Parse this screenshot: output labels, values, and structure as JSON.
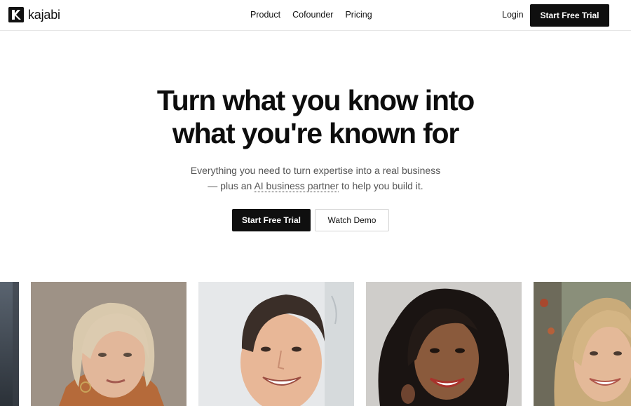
{
  "brand": {
    "name": "kajabi"
  },
  "nav": {
    "links": [
      "Product",
      "Cofounder",
      "Pricing"
    ],
    "login": "Login",
    "cta": "Start Free Trial"
  },
  "hero": {
    "title_line1": "Turn what you know into",
    "title_line2": "what you're known for",
    "subtitle_line1": "Everything you need to turn expertise into a real business",
    "subtitle_pre": "— plus an ",
    "subtitle_link": "AI business partner",
    "subtitle_post": " to help you build it.",
    "primary_cta": "Start Free Trial",
    "secondary_cta": "Watch Demo"
  },
  "colors": {
    "primary": "#0f0f0f",
    "text": "#111111",
    "muted": "#555555",
    "border": "#d4d4d4"
  },
  "photos": [
    {
      "name": "partial-photo-left"
    },
    {
      "name": "creator-photo-woman-silver-hair"
    },
    {
      "name": "creator-photo-man-smiling"
    },
    {
      "name": "creator-photo-woman-curly-hair"
    },
    {
      "name": "creator-photo-woman-blonde"
    }
  ]
}
